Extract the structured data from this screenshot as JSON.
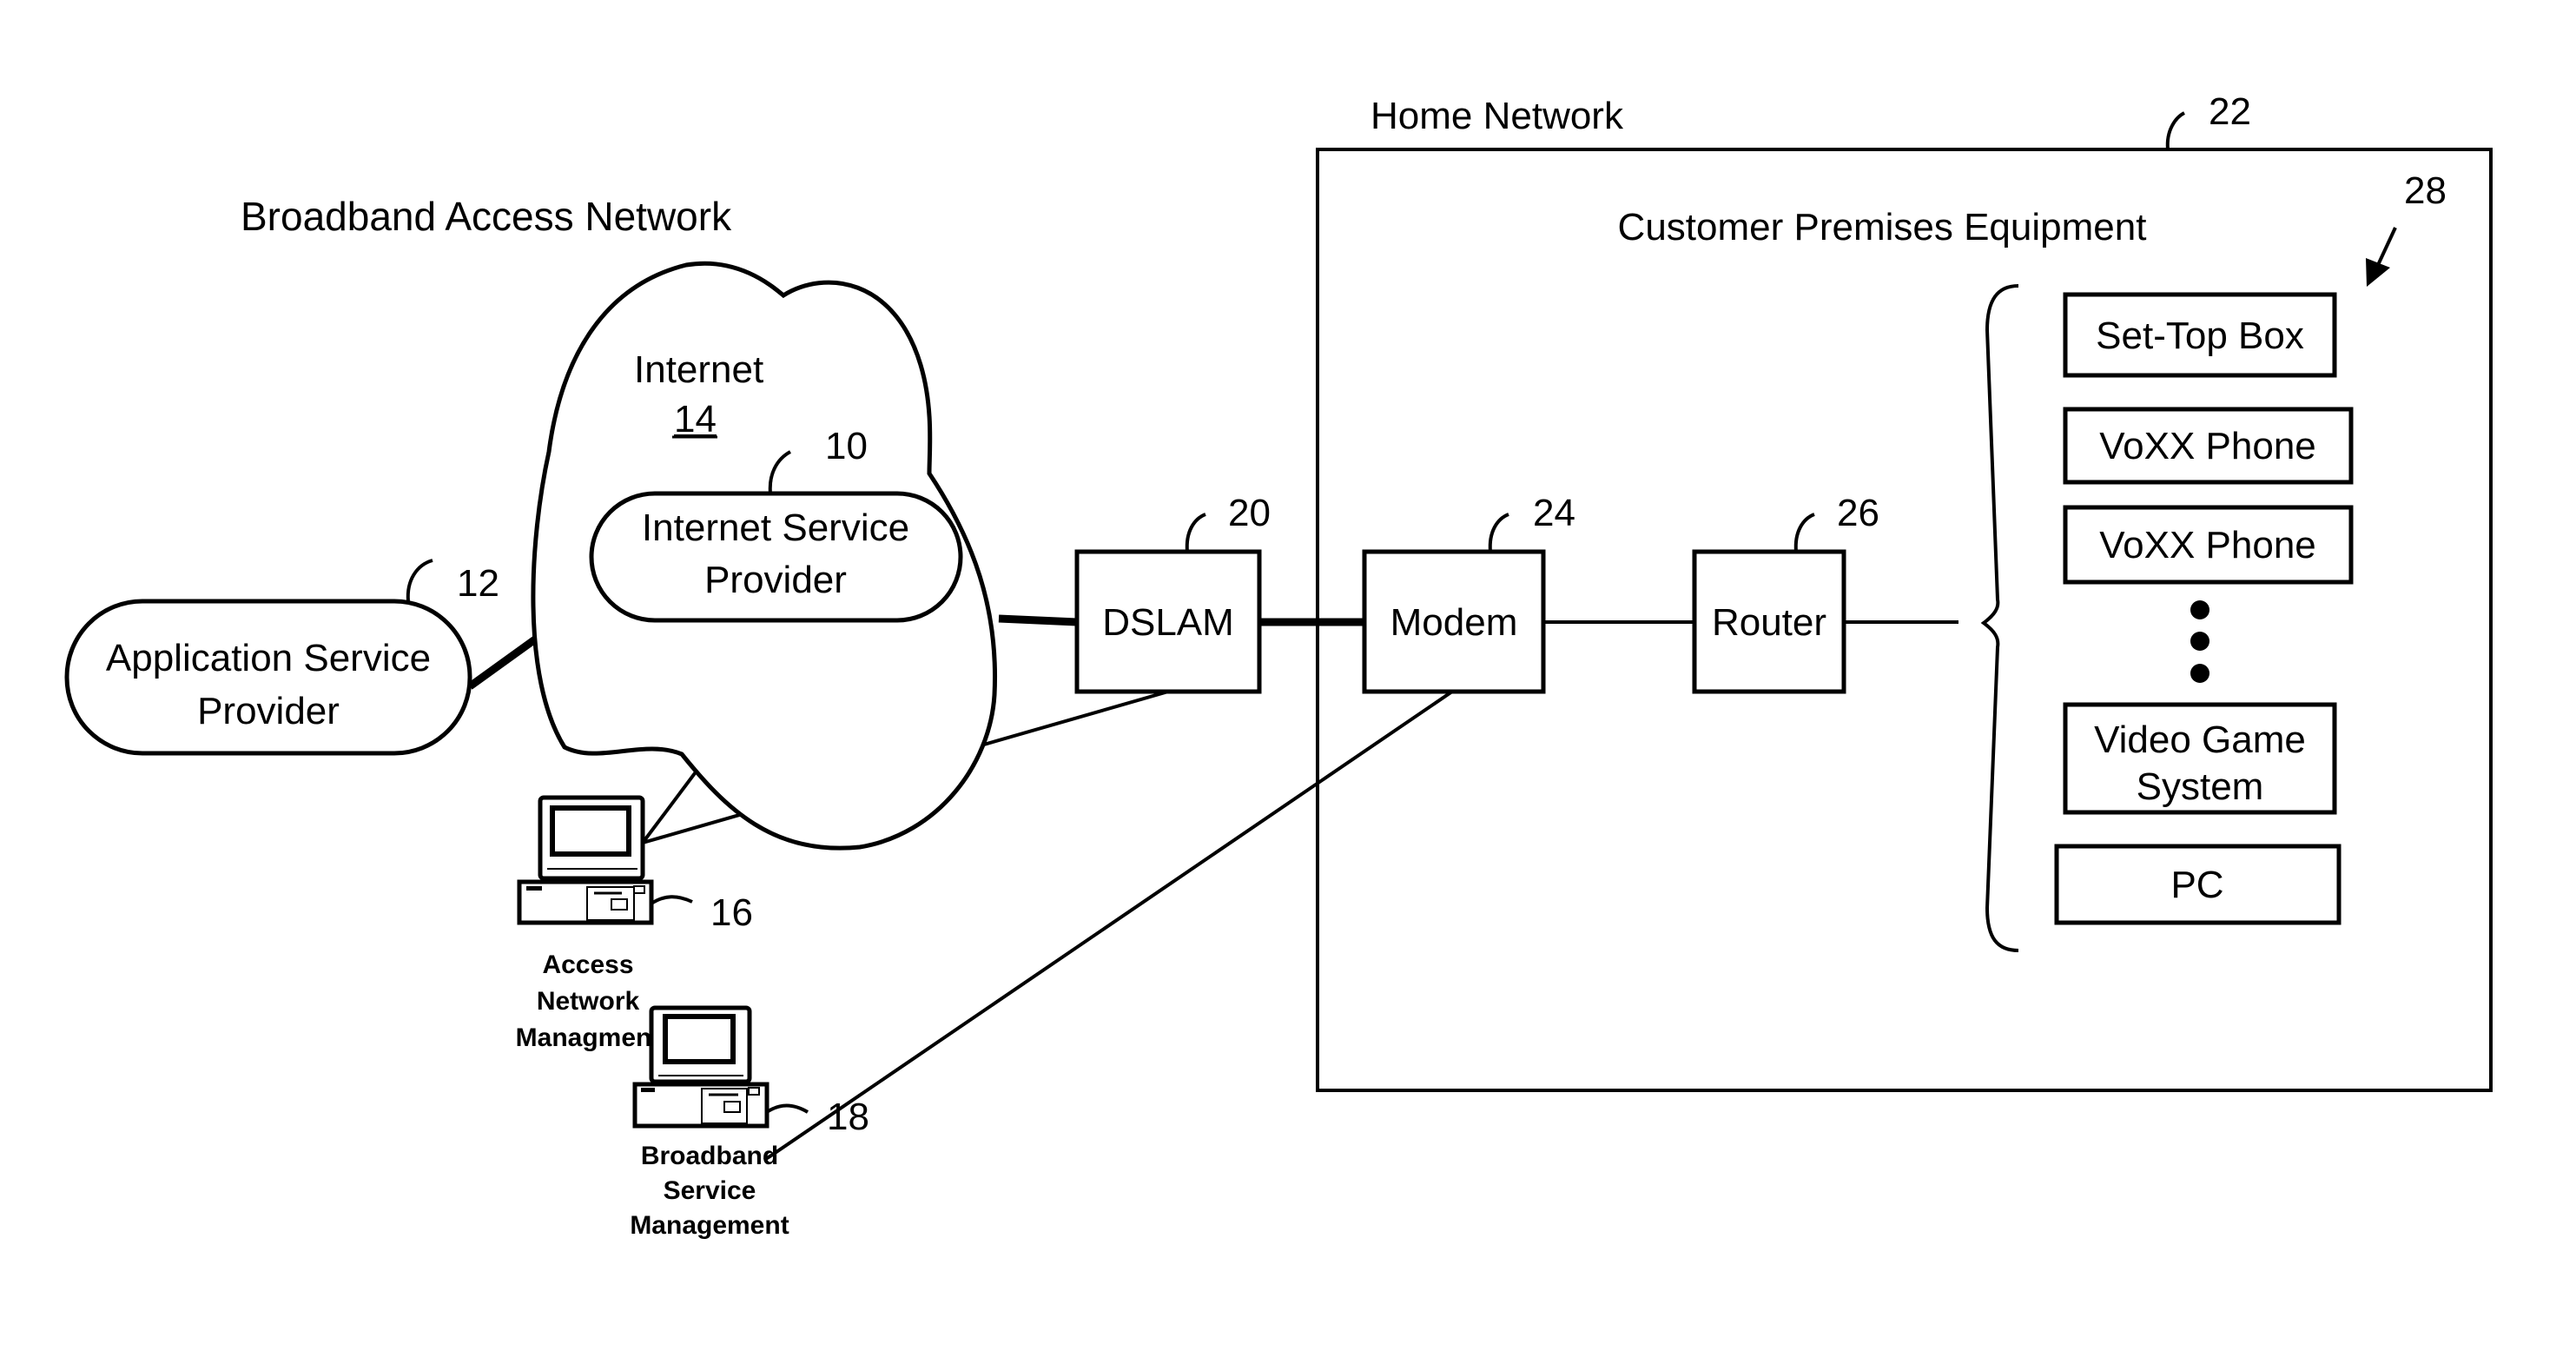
{
  "diagram": {
    "regions": {
      "access_network_title": "Broadband Access Network",
      "home_network_title": "Home Network",
      "home_network_ref": "22",
      "cpe_title": "Customer Premises Equipment",
      "cpe_ref": "28"
    },
    "internet": {
      "label": "Internet",
      "ref": "14"
    },
    "isp": {
      "line1": "Internet Service",
      "line2": "Provider",
      "ref": "10"
    },
    "asp": {
      "line1": "Application Service",
      "line2": "Provider",
      "ref": "12"
    },
    "dslam": {
      "label": "DSLAM",
      "ref": "20"
    },
    "modem": {
      "label": "Modem",
      "ref": "24"
    },
    "router": {
      "label": "Router",
      "ref": "26"
    },
    "access_mgmt": {
      "line1": "Access",
      "line2": "Network",
      "line3": "Managment",
      "ref": "16"
    },
    "broadband_mgmt": {
      "line1": "Broadband",
      "line2": "Service",
      "line3": "Management",
      "ref": "18"
    },
    "devices": [
      {
        "line1": "Set-Top Box"
      },
      {
        "line1": "VoXX Phone"
      },
      {
        "line1": "VoXX Phone"
      },
      {
        "line1": "Video Game",
        "line2": "System"
      },
      {
        "line1": "PC"
      }
    ],
    "ellipsis": "more devices"
  }
}
